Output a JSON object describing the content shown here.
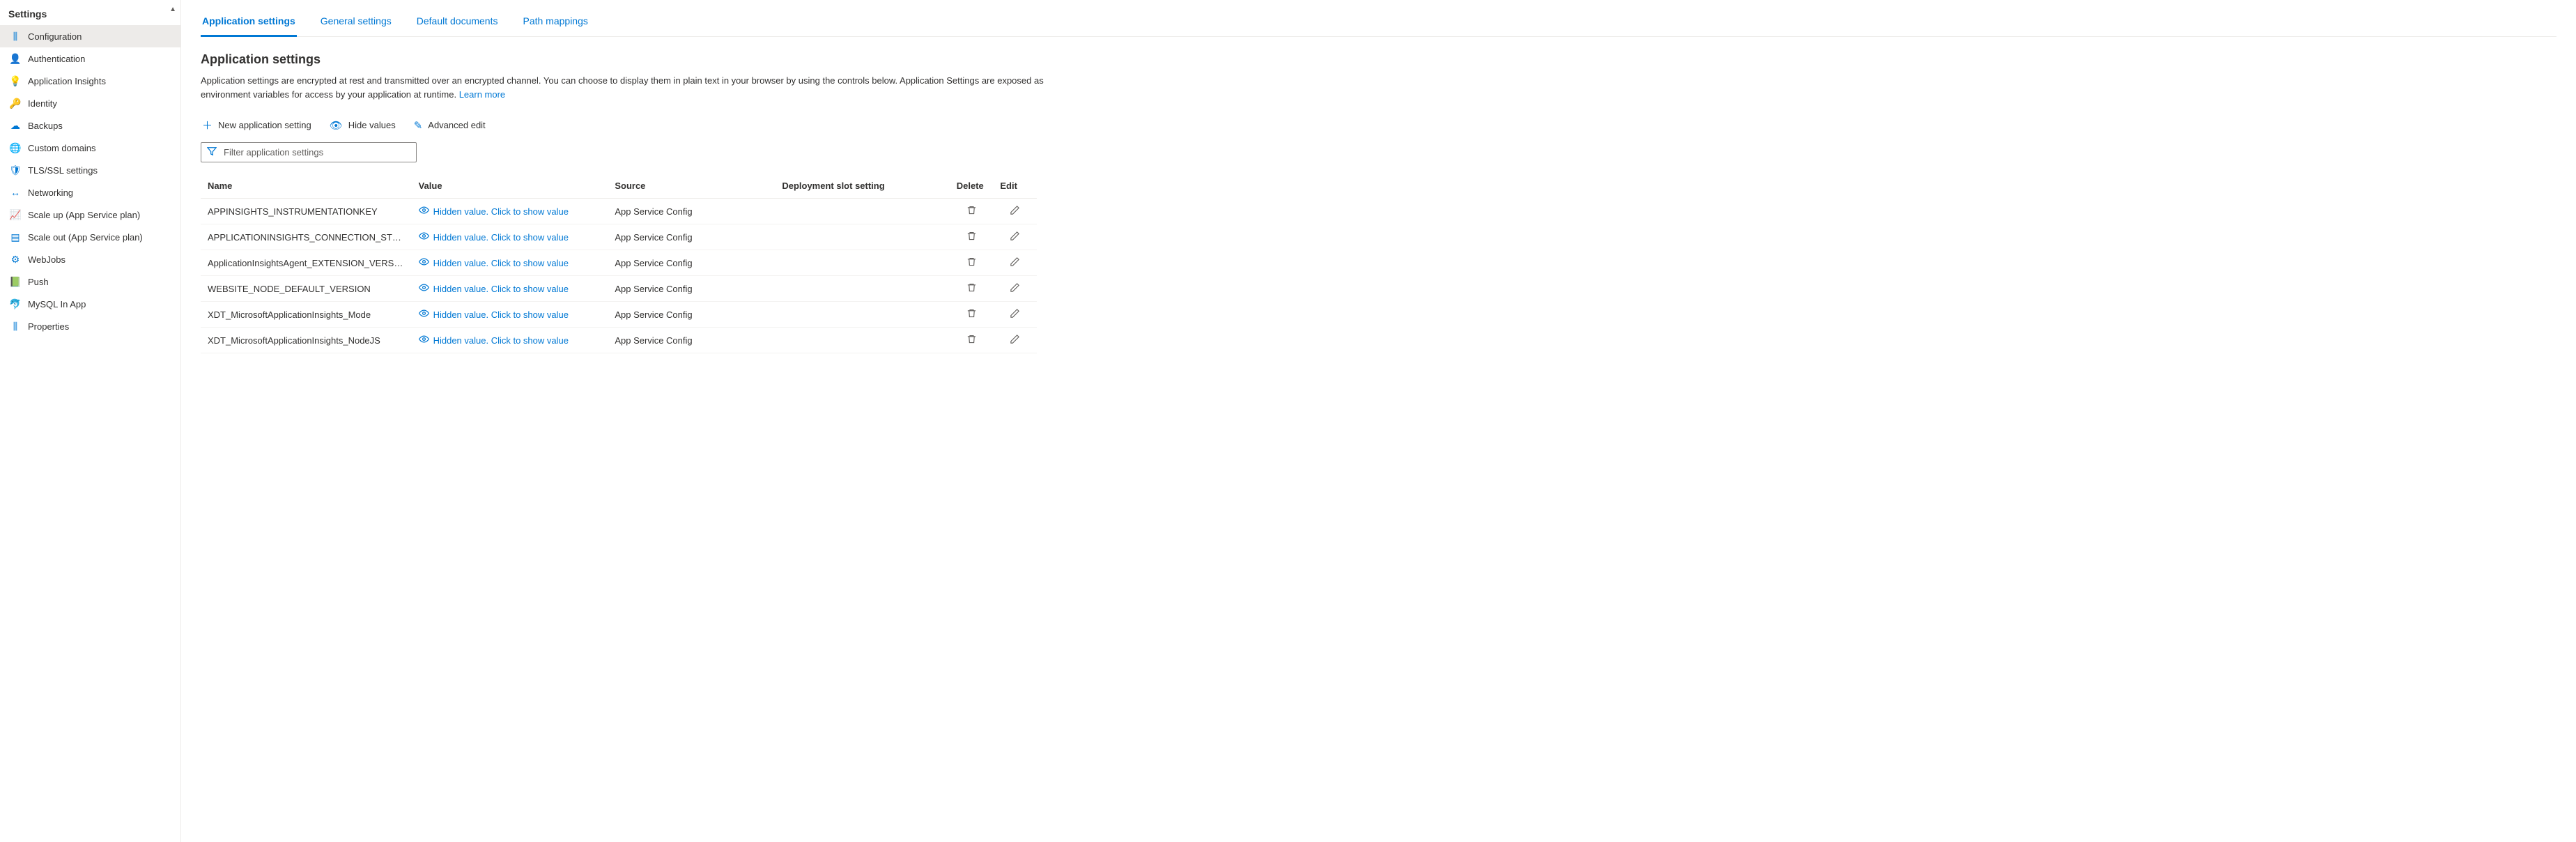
{
  "sidebar": {
    "title": "Settings",
    "items": [
      {
        "icon": "⫼",
        "label": "Configuration",
        "color": "#0078d4",
        "active": true
      },
      {
        "icon": "👤",
        "label": "Authentication",
        "color": "#0078d4"
      },
      {
        "icon": "💡",
        "label": "Application Insights",
        "color": "#8661c5"
      },
      {
        "icon": "🔑",
        "label": "Identity",
        "color": "#ffb900"
      },
      {
        "icon": "☁",
        "label": "Backups",
        "color": "#0078d4"
      },
      {
        "icon": "🌐",
        "label": "Custom domains",
        "color": "#0078d4"
      },
      {
        "icon": "🛡",
        "label": "TLS/SSL settings",
        "color": "#0078d4"
      },
      {
        "icon": "↔",
        "label": "Networking",
        "color": "#0078d4"
      },
      {
        "icon": "📈",
        "label": "Scale up (App Service plan)",
        "color": "#0078d4"
      },
      {
        "icon": "▤",
        "label": "Scale out (App Service plan)",
        "color": "#0078d4"
      },
      {
        "icon": "⚙",
        "label": "WebJobs",
        "color": "#0078d4"
      },
      {
        "icon": "📗",
        "label": "Push",
        "color": "#107c10"
      },
      {
        "icon": "🐬",
        "label": "MySQL In App",
        "color": "#0078d4"
      },
      {
        "icon": "⫼",
        "label": "Properties",
        "color": "#0078d4"
      }
    ]
  },
  "tabs": [
    {
      "label": "Application settings",
      "active": true
    },
    {
      "label": "General settings"
    },
    {
      "label": "Default documents"
    },
    {
      "label": "Path mappings"
    }
  ],
  "section": {
    "title": "Application settings",
    "desc": "Application settings are encrypted at rest and transmitted over an encrypted channel. You can choose to display them in plain text in your browser by using the controls below. Application Settings are exposed as environment variables for access by your application at runtime. ",
    "learn_more": "Learn more"
  },
  "toolbar": {
    "new": "New application setting",
    "hide": "Hide values",
    "advanced": "Advanced edit",
    "filter_placeholder": "Filter application settings"
  },
  "table": {
    "headers": {
      "name": "Name",
      "value": "Value",
      "source": "Source",
      "slot": "Deployment slot setting",
      "delete": "Delete",
      "edit": "Edit"
    },
    "hidden_text": "Hidden value. Click to show value",
    "rows": [
      {
        "name": "APPINSIGHTS_INSTRUMENTATIONKEY",
        "source": "App Service Config"
      },
      {
        "name": "APPLICATIONINSIGHTS_CONNECTION_STRING",
        "source": "App Service Config"
      },
      {
        "name": "ApplicationInsightsAgent_EXTENSION_VERSION",
        "source": "App Service Config"
      },
      {
        "name": "WEBSITE_NODE_DEFAULT_VERSION",
        "source": "App Service Config"
      },
      {
        "name": "XDT_MicrosoftApplicationInsights_Mode",
        "source": "App Service Config"
      },
      {
        "name": "XDT_MicrosoftApplicationInsights_NodeJS",
        "source": "App Service Config"
      }
    ]
  }
}
